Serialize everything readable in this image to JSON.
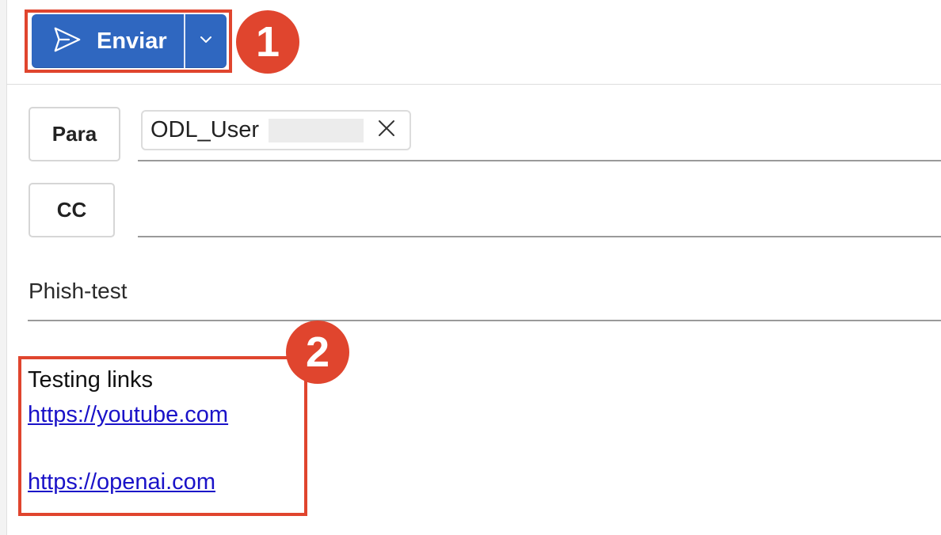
{
  "toolbar": {
    "send_label": "Enviar"
  },
  "annotations": {
    "badge_1": "1",
    "badge_2": "2",
    "highlight_color": "#e0452e"
  },
  "recipients": {
    "to_label": "Para",
    "cc_label": "CC",
    "to_chips": [
      {
        "name": "ODL_User"
      }
    ]
  },
  "subject": "Phish-test",
  "body": {
    "line1": "Testing links",
    "links": [
      "https://youtube.com",
      "https://openai.com"
    ]
  },
  "colors": {
    "send_button": "#2f67c0",
    "link": "#1a12c8"
  },
  "icons": {
    "send": "send-icon",
    "dropdown": "chevron-down-icon",
    "chip_remove": "close-icon"
  }
}
